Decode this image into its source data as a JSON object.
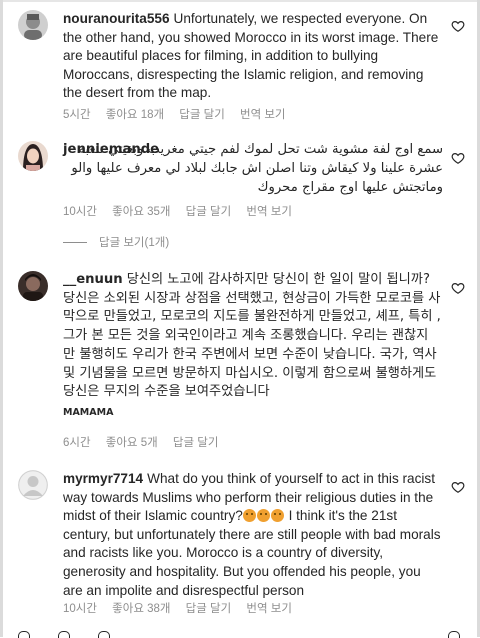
{
  "comments": [
    {
      "username": "nouranourita556",
      "text": "Unfortunately, we respected everyone. On the other hand, you showed Morocco in its worst image. There are beautiful places for filming, in addition to bullying Moroccans, disrespecting the Islamic religion, and removing the desert from the map.",
      "time": "5시간",
      "likes": "좋아요 18개",
      "reply": "답글 달기",
      "translate": "번역 보기"
    },
    {
      "username": "jenniemande",
      "text": "سمع اوج لفة مشوية شت تحل لموك لفم جيتي مغريب وبغيتي تلعبة عشرة علينا ولا كيقاش وتنا اصلن اش جابك لبلاد لي معرف عليها والو وماتجتش عليها اوج مقراج محروك",
      "time": "10시간",
      "likes": "좋아요 35개",
      "reply": "답글 달기",
      "translate": "번역 보기",
      "view_replies": "답글 보기(1개)"
    },
    {
      "username": "__enuun",
      "text": "당신의 노고에 감사하지만 당신이 한 일이 말이 됩니까? 당신은 소외된 시장과 상점을 선택했고, 현상금이 가득한 모로코를 사막으로 만들었고, 모로코의 지도를 불완전하게 만들었고, 셰프, 특히 , 그가 본 모든 것을 외국인이라고 계속 조롱했습니다. 우리는 괜찮지 만 불행히도 우리가 한국 주변에서 보면 수준이 낮습니다. 국가, 역사 및 기념물을 모르면 방문하지 마십시오. 이렇게 함으로써 불행하게도 당신은 무지의 수준을 보여주었습니다",
      "subtext": "MAMAMA",
      "time": "6시간",
      "likes": "좋아요 5개",
      "reply": "답글 달기"
    },
    {
      "username": "myrmyr7714",
      "text_a": "What do you think of yourself to act in this racist way towards Muslims who perform their religious duties in the midst of their Islamic country?",
      "text_b": " I think it's the 21st century, but unfortunately there are still people with bad morals and racists like you. Morocco is a country of diversity, generosity and hospitality. But you offended his people, you are an impolite and disrespectful person",
      "time": "10시간",
      "likes": "좋아요 38개",
      "reply": "답글 달기",
      "translate": "번역 보기"
    }
  ],
  "colors": {
    "text": "#262626",
    "secondary": "#8e8e8e",
    "divider": "#dbdbdb"
  },
  "icons": {
    "like": "heart-outline-icon",
    "emoji": "crying-face-emoji"
  }
}
